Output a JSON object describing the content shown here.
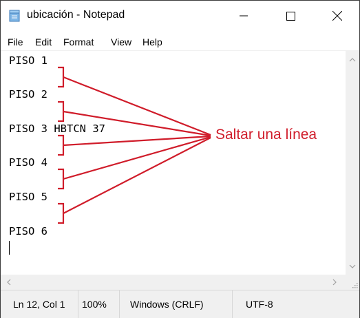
{
  "window": {
    "title": "ubicación - Notepad"
  },
  "menu": {
    "items": [
      "File",
      "Edit",
      "Format",
      "View",
      "Help"
    ]
  },
  "editor": {
    "lines": [
      {
        "text": "PISO 1"
      },
      {
        "text": "PISO 2"
      },
      {
        "text": "PISO 3 HBTCN 37"
      },
      {
        "text": "PISO 4"
      },
      {
        "text": "PISO 5"
      },
      {
        "text": "PISO 6"
      }
    ]
  },
  "annotation": {
    "label": "Saltar una línea",
    "color": "#d01c2a"
  },
  "status": {
    "position": "Ln 12, Col 1",
    "zoom": "100%",
    "line_ending": "Windows (CRLF)",
    "encoding": "UTF-8"
  },
  "icons": {
    "app": "notepad-icon",
    "minimize": "minimize-icon",
    "maximize": "maximize-icon",
    "close": "close-icon",
    "scroll_up": "chevron-up-icon",
    "scroll_down": "chevron-down-icon",
    "scroll_left": "chevron-left-icon",
    "scroll_right": "chevron-right-icon"
  }
}
